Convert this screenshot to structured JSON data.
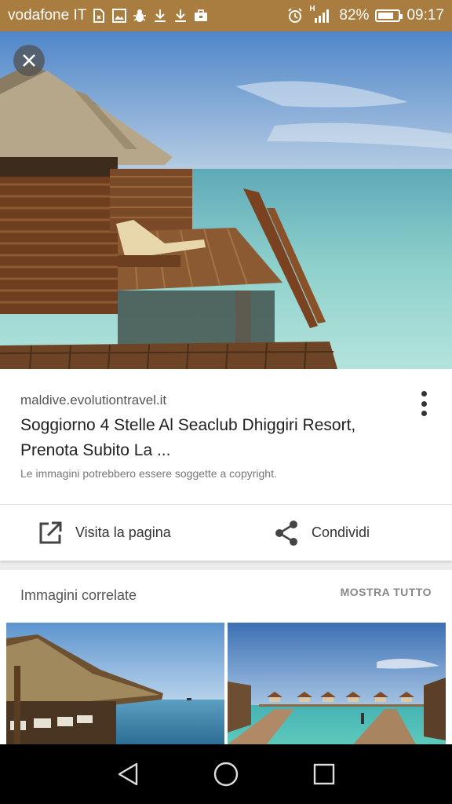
{
  "status_bar": {
    "carrier": "vodafone IT",
    "battery_percent": "82%",
    "battery_level": 0.82,
    "time": "09:17",
    "network_type": "H",
    "icons": [
      "sim-icon",
      "image-icon",
      "bug-icon",
      "download-icon",
      "download-icon",
      "briefcase-icon",
      "alarm-icon",
      "signal-icon",
      "battery-icon"
    ]
  },
  "hero": {
    "close_icon": "close-icon"
  },
  "result": {
    "domain": "maldive.evolutiontravel.it",
    "title": "Soggiorno 4 Stelle Al Seaclub Dhiggiri Resort, Prenota Subito La ...",
    "copyright_notice": "Le immagini potrebbero essere soggette a copyright."
  },
  "actions": {
    "visit_label": "Visita la pagina",
    "share_label": "Condividi"
  },
  "related": {
    "title": "Immagini correlate",
    "show_all": "MOSTRA TUTTO"
  },
  "colors": {
    "status_bar": "#a97d3f",
    "card": "#ffffff",
    "text_primary": "#212121",
    "text_secondary": "#555555"
  }
}
